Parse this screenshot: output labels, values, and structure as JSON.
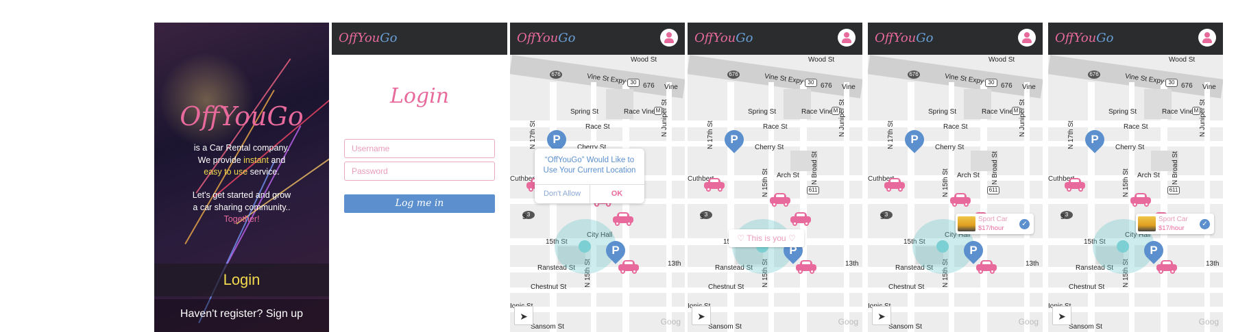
{
  "colors": {
    "brand_pink": "#e86a9c",
    "brand_blue": "#5b8fce",
    "topbar": "#2b2c2e",
    "highlight_yellow": "#f2d94e"
  },
  "brand": {
    "part1": "OffYou",
    "part2": "Go"
  },
  "splash": {
    "line1": "is a Car Rental company.",
    "line2_pre": "We provide ",
    "line2_hl": "instant",
    "line2_post": " and",
    "line3_hl": "easy to use",
    "line3_post": " service.",
    "line4": "Let's get started and grow",
    "line5": "a car sharing community..",
    "line6": "Together!",
    "login_label": "Login",
    "signup_label": "Haven't register? Sign up"
  },
  "login": {
    "title": "Login",
    "username_placeholder": "Username",
    "password_placeholder": "Password",
    "button_label": "Log me in"
  },
  "map": {
    "streets": {
      "wood": "Wood St",
      "vine_expy": "Vine St Expy",
      "shield_676": "676",
      "shield_30": "30",
      "vine": "Vine",
      "spring": "Spring St",
      "race_vine": "Race Vine",
      "metro": "M",
      "race": "Race St",
      "cherry": "Cherry St",
      "arch": "Arch St",
      "cuthbert": "Cuthbert",
      "n17": "N 17th St",
      "n15": "N 15th St",
      "nbroad": "N Broad St",
      "njuniper": "N Juniper St",
      "shield_611": "611",
      "shield_3": "3",
      "s15": "15th St",
      "cityhall": "City Hall",
      "ransted": "Ranstead St",
      "chestnut": "Chestnut St",
      "ionic": "Ionic St",
      "sansom": "Sansom St",
      "s13": "13th",
      "n13": "13th",
      "s3": "3"
    },
    "parking_glyph": "P",
    "locate_icon": "➤",
    "google": "Goog"
  },
  "location_dialog": {
    "title_l1": "“OffYouGo” Would Like to",
    "title_l2": "Use Your Current Location",
    "deny": "Don't Allow",
    "ok": "OK"
  },
  "this_is_you": "♡ This is you ♡",
  "car_card": {
    "name": "Sport Car",
    "price": "$17/hour",
    "check": "✓"
  }
}
